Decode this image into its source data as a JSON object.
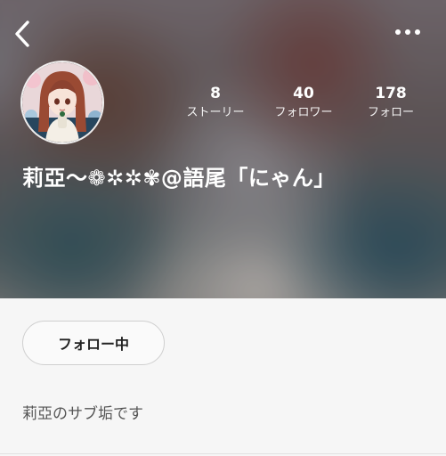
{
  "header": {
    "back_icon": "chevron-left-icon",
    "more_icon": "more-horizontal-icon"
  },
  "profile": {
    "avatar_icon": "avatar",
    "stats": [
      {
        "value": "8",
        "label": "ストーリー"
      },
      {
        "value": "40",
        "label": "フォロワー"
      },
      {
        "value": "178",
        "label": "フォロー"
      }
    ],
    "username": "莉亞〜❁✲✲✾@語尾「にゃん」",
    "follow_label": "フォロー中",
    "bio": "莉亞のサブ垢です"
  },
  "colors": {
    "text_on_header": "#ffffff",
    "page_background": "#f6f6f6",
    "button_border": "#cfcfcf"
  }
}
